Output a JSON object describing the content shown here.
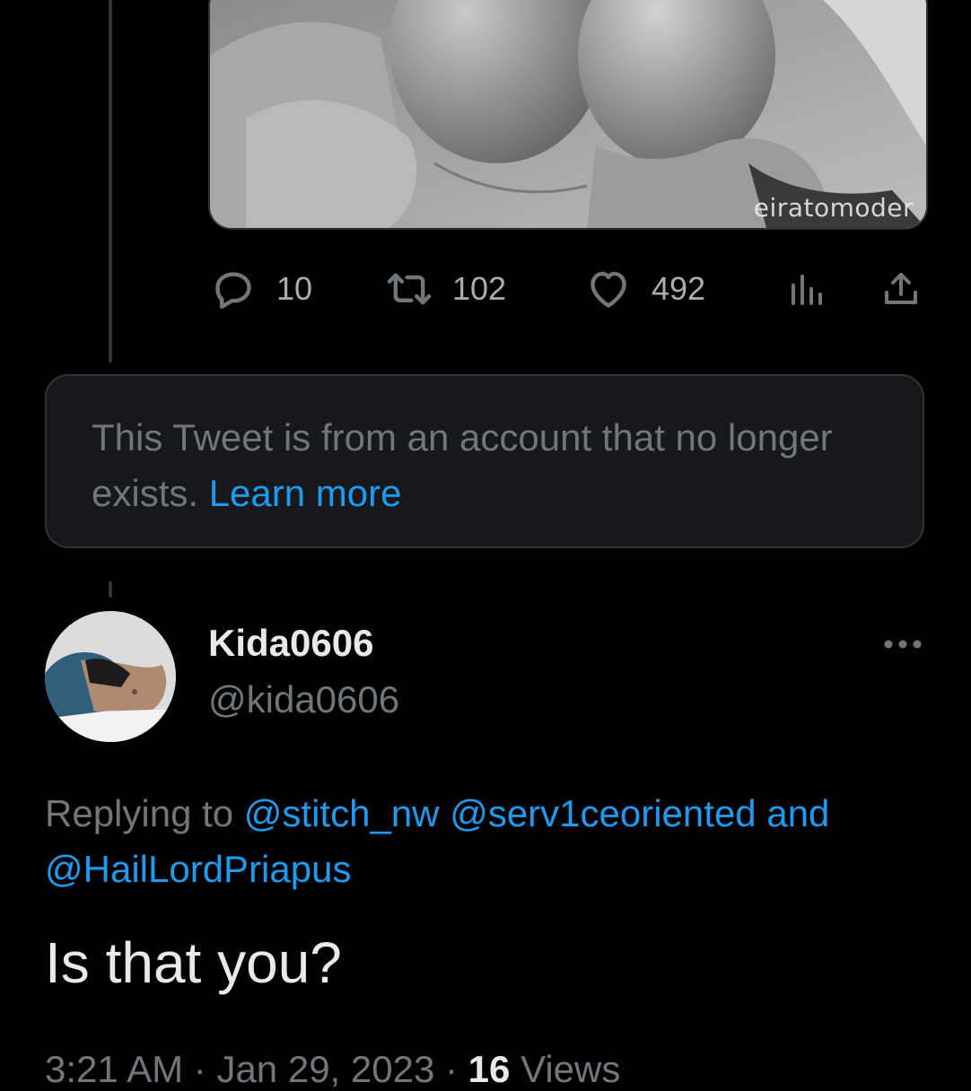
{
  "media": {
    "watermark": "eiratomoder"
  },
  "actions": {
    "replies": "10",
    "retweets": "102",
    "likes": "492"
  },
  "notice": {
    "text": "This Tweet is from an account that no longer exists.",
    "link": "Learn more"
  },
  "reply": {
    "display_name": "Kida0606",
    "handle": "@kida0606",
    "replying_prefix": "Replying to",
    "mention_1": "@stitch_nw",
    "mention_2": "@serv1ceoriented",
    "conjunction": "and",
    "mention_3": "@HailLordPriapus",
    "text": "Is that you?",
    "time": "3:21 AM",
    "date": "Jan 29, 2023",
    "separator": "·",
    "views_count": "16",
    "views_label": "Views"
  },
  "colors": {
    "background": "#000000",
    "card": "#16181c",
    "border": "#2f3336",
    "muted": "#71767b",
    "link": "#1d9bf0",
    "text": "#e7e9ea"
  },
  "icons": [
    "reply-icon",
    "retweet-icon",
    "like-icon",
    "analytics-icon",
    "share-icon",
    "more-icon"
  ]
}
